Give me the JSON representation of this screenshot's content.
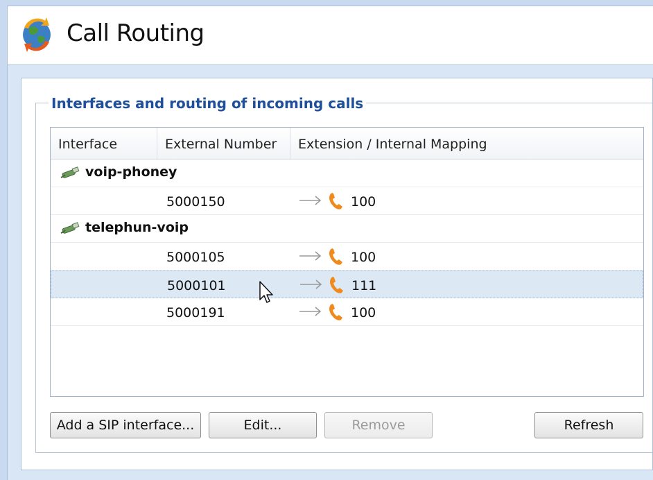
{
  "header": {
    "title": "Call Routing",
    "icon": "call-routing-globe-icon"
  },
  "group": {
    "title": "Interfaces and routing of incoming calls"
  },
  "table": {
    "columns": [
      "Interface",
      "External Number",
      "Extension / Internal Mapping"
    ],
    "interfaces": [
      {
        "name": "voip-phoney",
        "icon": "network-cable-icon",
        "routes": [
          {
            "external": "5000150",
            "extension": "100"
          }
        ]
      },
      {
        "name": "telephun-voip",
        "icon": "network-cable-icon",
        "routes": [
          {
            "external": "5000105",
            "extension": "100"
          },
          {
            "external": "5000101",
            "extension": "111",
            "selected": true
          },
          {
            "external": "5000191",
            "extension": "100"
          }
        ]
      }
    ]
  },
  "buttons": {
    "add_sip": "Add a SIP interface...",
    "edit": "Edit...",
    "remove": "Remove",
    "refresh": "Refresh"
  },
  "colors": {
    "group_title": "#1f4f9a",
    "selection": "#dde8f5",
    "phone": "#f08a1c"
  }
}
